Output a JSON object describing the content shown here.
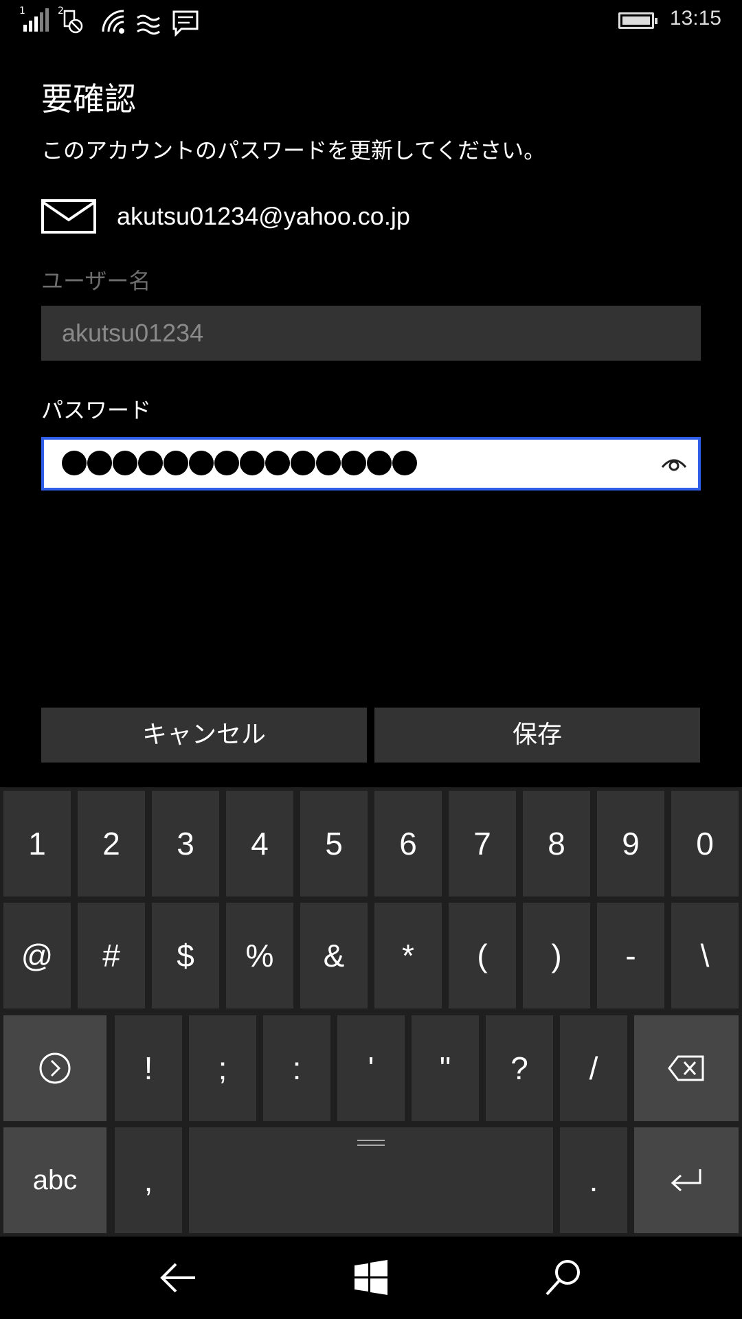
{
  "status_bar": {
    "sim1_label": "1",
    "sim2_label": "2",
    "time": "13:15",
    "icons": [
      "signal-sim1-icon",
      "sim2-no-signal-icon",
      "wifi-icon",
      "wifi-calling-icon",
      "message-icon",
      "battery-icon"
    ]
  },
  "dialog": {
    "title": "要確認",
    "subtitle": "このアカウントのパスワードを更新してください。",
    "account_email": "akutsu01234@yahoo.co.jp",
    "username_label": "ユーザー名",
    "username_value": "akutsu01234",
    "password_label": "パスワード",
    "password_mask_count": 14,
    "cancel_label": "キャンセル",
    "save_label": "保存"
  },
  "keyboard": {
    "row1": [
      "1",
      "2",
      "3",
      "4",
      "5",
      "6",
      "7",
      "8",
      "9",
      "0"
    ],
    "row2": [
      "@",
      "#",
      "$",
      "%",
      "&",
      "*",
      "(",
      ")",
      "-",
      "\\"
    ],
    "row3": [
      "!",
      ";",
      ":",
      "'",
      "\"",
      "?",
      "/"
    ],
    "row4": {
      "abc": "abc",
      "comma": ",",
      "period": "."
    }
  },
  "colors": {
    "focus_border": "#2f5fe8",
    "background": "#000000",
    "key": "#333333",
    "special_key": "#464646"
  }
}
